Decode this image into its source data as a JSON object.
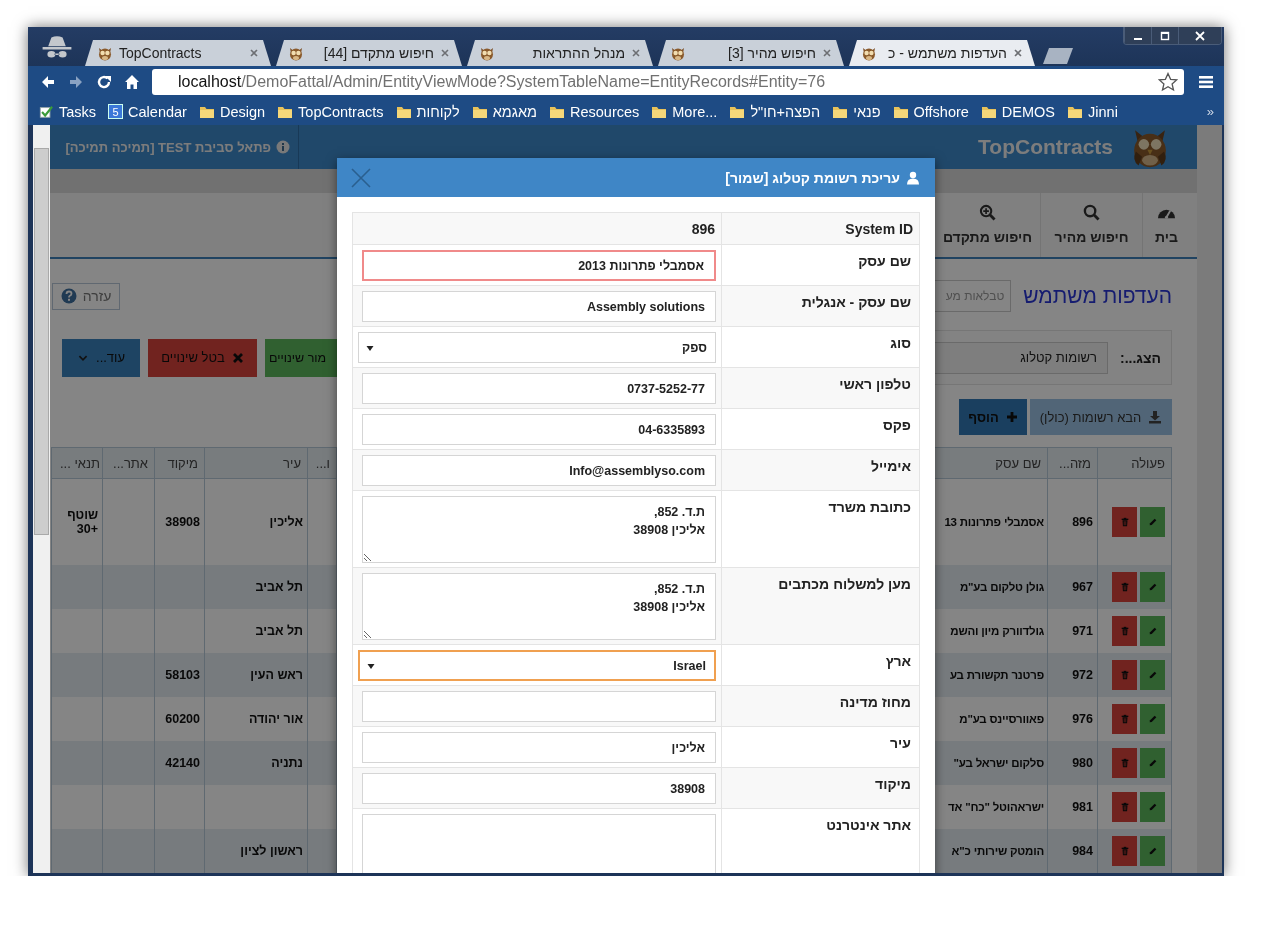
{
  "browser": {
    "tabs": [
      {
        "title": "העדפות משתמש - כ",
        "selected": true
      },
      {
        "title": "חיפוש מהיר [3]",
        "selected": false
      },
      {
        "title": "מנהל ההתראות",
        "selected": false
      },
      {
        "title": "חיפוש מתקדם [44]",
        "selected": false
      },
      {
        "title": "TopContracts",
        "selected": false
      }
    ],
    "url": {
      "host": "localhost",
      "path": "/DemoFattal/Admin/EntityViewMode?SystemTableName=EntityRecords#Entity=76"
    },
    "bookmarks": [
      {
        "label": "Jinni",
        "kind": "folder"
      },
      {
        "label": "DEMOS",
        "kind": "folder"
      },
      {
        "label": "Offshore",
        "kind": "folder"
      },
      {
        "label": "פנאי",
        "kind": "folder"
      },
      {
        "label": "הפצה+חו\"ל",
        "kind": "folder"
      },
      {
        "label": "More...",
        "kind": "folder"
      },
      {
        "label": "Resources",
        "kind": "folder"
      },
      {
        "label": "מאגמא",
        "kind": "folder"
      },
      {
        "label": "לקוחות",
        "kind": "folder"
      },
      {
        "label": "TopContracts",
        "kind": "folder"
      },
      {
        "label": "Design",
        "kind": "folder"
      },
      {
        "label": "Calendar",
        "kind": "calendar",
        "icon_text": "5"
      },
      {
        "label": "Tasks",
        "kind": "tasks"
      }
    ],
    "bookmarks_overflow": "»"
  },
  "app": {
    "brand": "TopContracts",
    "environment": "פתאל סביבת TEST [תמיכה תמיכה]",
    "nav": [
      {
        "label": "בית",
        "kind": "home"
      },
      {
        "label": "חיפוש מהיר",
        "kind": "quick_search"
      },
      {
        "label": "חיפוש מתקדם",
        "kind": "advanced_search"
      }
    ],
    "title": "העדפות משתמש",
    "table_search": {
      "placeholder": "טבלאות מע"
    },
    "help_button": "עזרה",
    "filter": {
      "label": "הצג...:",
      "value": "רשומות קטלוג"
    },
    "action_buttons": [
      {
        "label": "מור שינויים",
        "kind": "save"
      },
      {
        "label": "בטל שינויים",
        "kind": "cancel"
      },
      {
        "label": "עוד...",
        "kind": "more"
      }
    ],
    "list_buttons": [
      {
        "label": "הבא רשומות (כולן)",
        "kind": "fetch"
      },
      {
        "label": "הוסף",
        "kind": "add"
      }
    ],
    "table": {
      "columns": [
        "פעולה",
        "מזה...",
        "שם עסק",
        "ו...",
        "עיר",
        "מיקוד",
        "אתר...",
        "תנאי ..."
      ],
      "rows": [
        {
          "id": "896",
          "name": "אסמבלי פתרונות 13",
          "city": "אליכין",
          "zip": "38908",
          "terms": "שוטף +30"
        },
        {
          "id": "967",
          "name": "גולן טלקום בע\"מ",
          "city": "תל אביב"
        },
        {
          "id": "971",
          "name": "גולדוורק מיון והשמ",
          "city": "תל אביב"
        },
        {
          "id": "972",
          "name": "פרטנר תקשורת בע",
          "city": "ראש העין",
          "zip": "58103"
        },
        {
          "id": "976",
          "name": "פאוורסיינס בע\"מ",
          "city": "אור יהודה",
          "zip": "60200"
        },
        {
          "id": "980",
          "name": "סלקום ישראל בע\"",
          "city": "נתניה",
          "zip": "42140"
        },
        {
          "id": "981",
          "name": "ישראהוטל \"כח\" אד"
        },
        {
          "id": "984",
          "name": "הומטק שירותי כ\"א",
          "city": "ראשון לציון"
        }
      ]
    }
  },
  "modal": {
    "title": "עריכת רשומת קטלוג [שמור]",
    "fields": [
      {
        "label": "System ID",
        "kind": "readonly",
        "value": "896"
      },
      {
        "label": "שם עסק",
        "kind": "text",
        "value": "אסמבלי פתרונות 2013",
        "invalid": true,
        "focused": false
      },
      {
        "label": "שם עסק - אנגלית",
        "kind": "text",
        "value": "Assembly solutions",
        "invalid": false,
        "focused": false
      },
      {
        "label": "סוג",
        "kind": "select",
        "value": "ספק",
        "invalid": false,
        "focused": false
      },
      {
        "label": "טלפון ראשי",
        "kind": "text",
        "value": "0737-5252-77",
        "invalid": false,
        "focused": false
      },
      {
        "label": "פקס",
        "kind": "text",
        "value": "04-6335893",
        "invalid": false,
        "focused": false
      },
      {
        "label": "אימייל",
        "kind": "text",
        "value": "Info@assemblyso.com",
        "invalid": false,
        "focused": false
      },
      {
        "label": "כתובת משרד",
        "kind": "textarea",
        "value": "ת.ד. 852,\nאליכין 38908",
        "invalid": false,
        "focused": false
      },
      {
        "label": "מען למשלוח מכתבים",
        "kind": "textarea",
        "value": "ת.ד. 852,\nאליכין 38908",
        "invalid": false,
        "focused": false
      },
      {
        "label": "ארץ",
        "kind": "select",
        "value": "Israel",
        "invalid": false,
        "focused": true
      },
      {
        "label": "מחוז מדינה",
        "kind": "text",
        "invalid": false,
        "focused": false
      },
      {
        "label": "עיר",
        "kind": "text",
        "value": "אליכין",
        "invalid": false,
        "focused": false
      },
      {
        "label": "מיקוד",
        "kind": "text",
        "value": "38908",
        "invalid": false,
        "focused": false
      },
      {
        "label": "אתר אינטרנט",
        "kind": "textarea",
        "invalid": false,
        "focused": false
      }
    ]
  }
}
